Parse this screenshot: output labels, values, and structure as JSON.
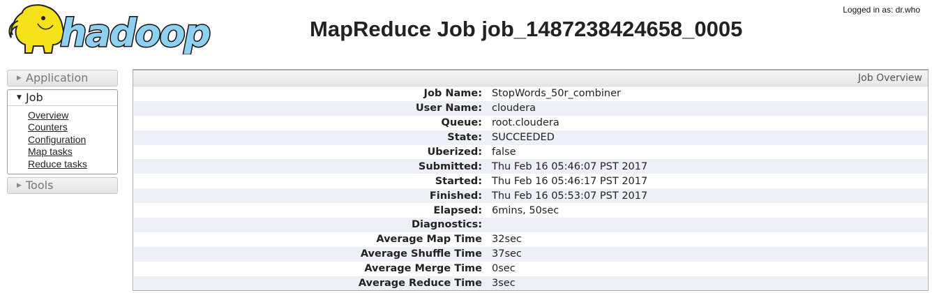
{
  "header": {
    "logo_text": "hadoop",
    "title": "MapReduce Job job_1487238424658_0005",
    "logged_in": "Logged in as: dr.who"
  },
  "nav": {
    "application": "Application",
    "job": "Job",
    "job_links": [
      "Overview",
      "Counters",
      "Configuration",
      "Map tasks",
      "Reduce tasks"
    ],
    "tools": "Tools"
  },
  "overview": {
    "header": "Job Overview",
    "rows": [
      {
        "label": "Job Name:",
        "value": "StopWords_50r_combiner"
      },
      {
        "label": "User Name:",
        "value": "cloudera"
      },
      {
        "label": "Queue:",
        "value": "root.cloudera"
      },
      {
        "label": "State:",
        "value": "SUCCEEDED"
      },
      {
        "label": "Uberized:",
        "value": "false"
      },
      {
        "label": "Submitted:",
        "value": "Thu Feb 16 05:46:07 PST 2017"
      },
      {
        "label": "Started:",
        "value": "Thu Feb 16 05:46:17 PST 2017"
      },
      {
        "label": "Finished:",
        "value": "Thu Feb 16 05:53:07 PST 2017"
      },
      {
        "label": "Elapsed:",
        "value": "6mins, 50sec"
      },
      {
        "label": "Diagnostics:",
        "value": ""
      },
      {
        "label": "Average Map Time",
        "value": "32sec"
      },
      {
        "label": "Average Shuffle Time",
        "value": "37sec"
      },
      {
        "label": "Average Merge Time",
        "value": "0sec"
      },
      {
        "label": "Average Reduce Time",
        "value": "3sec"
      }
    ]
  },
  "colors": {
    "logo_yellow": "#f5e21a",
    "logo_text_blue": "#8ed0ef",
    "row_stripe": "#eef0f8"
  },
  "icons": {
    "collapsed": "triangle-right-icon",
    "expanded": "triangle-down-icon"
  }
}
